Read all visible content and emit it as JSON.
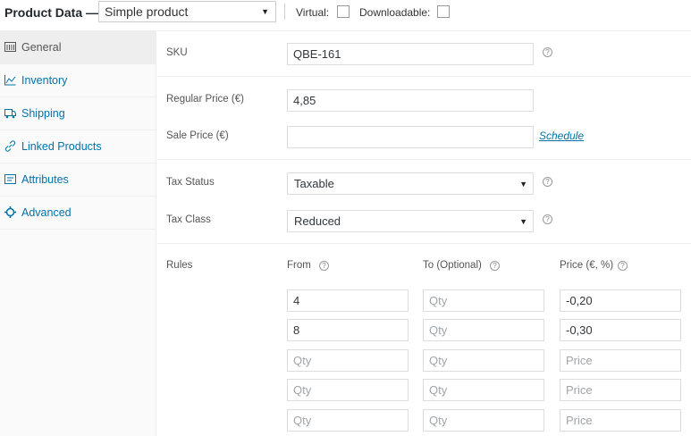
{
  "header": {
    "title": "Product Data —",
    "product_type": "Simple product",
    "virtual_label": "Virtual:",
    "downloadable_label": "Downloadable:"
  },
  "sidebar": {
    "tabs": [
      {
        "label": "General",
        "icon": "grid-icon"
      },
      {
        "label": "Inventory",
        "icon": "chart-icon"
      },
      {
        "label": "Shipping",
        "icon": "truck-icon"
      },
      {
        "label": "Linked Products",
        "icon": "link-icon"
      },
      {
        "label": "Attributes",
        "icon": "list-icon"
      },
      {
        "label": "Advanced",
        "icon": "gear-icon"
      }
    ]
  },
  "general": {
    "sku_label": "SKU",
    "sku_value": "QBE-161",
    "regular_price_label": "Regular Price (€)",
    "regular_price_value": "4,85",
    "sale_price_label": "Sale Price (€)",
    "sale_price_value": "",
    "schedule_link": "Schedule",
    "tax_status_label": "Tax Status",
    "tax_status_value": "Taxable",
    "tax_class_label": "Tax Class",
    "tax_class_value": "Reduced"
  },
  "rules": {
    "label": "Rules",
    "from_header": "From",
    "to_header": "To (Optional)",
    "price_header": "Price (€, %)",
    "from_placeholder": "Qty",
    "to_placeholder": "Qty",
    "price_placeholder": "Price",
    "rows": [
      {
        "from": "4",
        "to": "",
        "price": "-0,20"
      },
      {
        "from": "8",
        "to": "",
        "price": "-0,30"
      },
      {
        "from": "",
        "to": "",
        "price": ""
      },
      {
        "from": "",
        "to": "",
        "price": ""
      },
      {
        "from": "",
        "to": "",
        "price": ""
      }
    ]
  }
}
